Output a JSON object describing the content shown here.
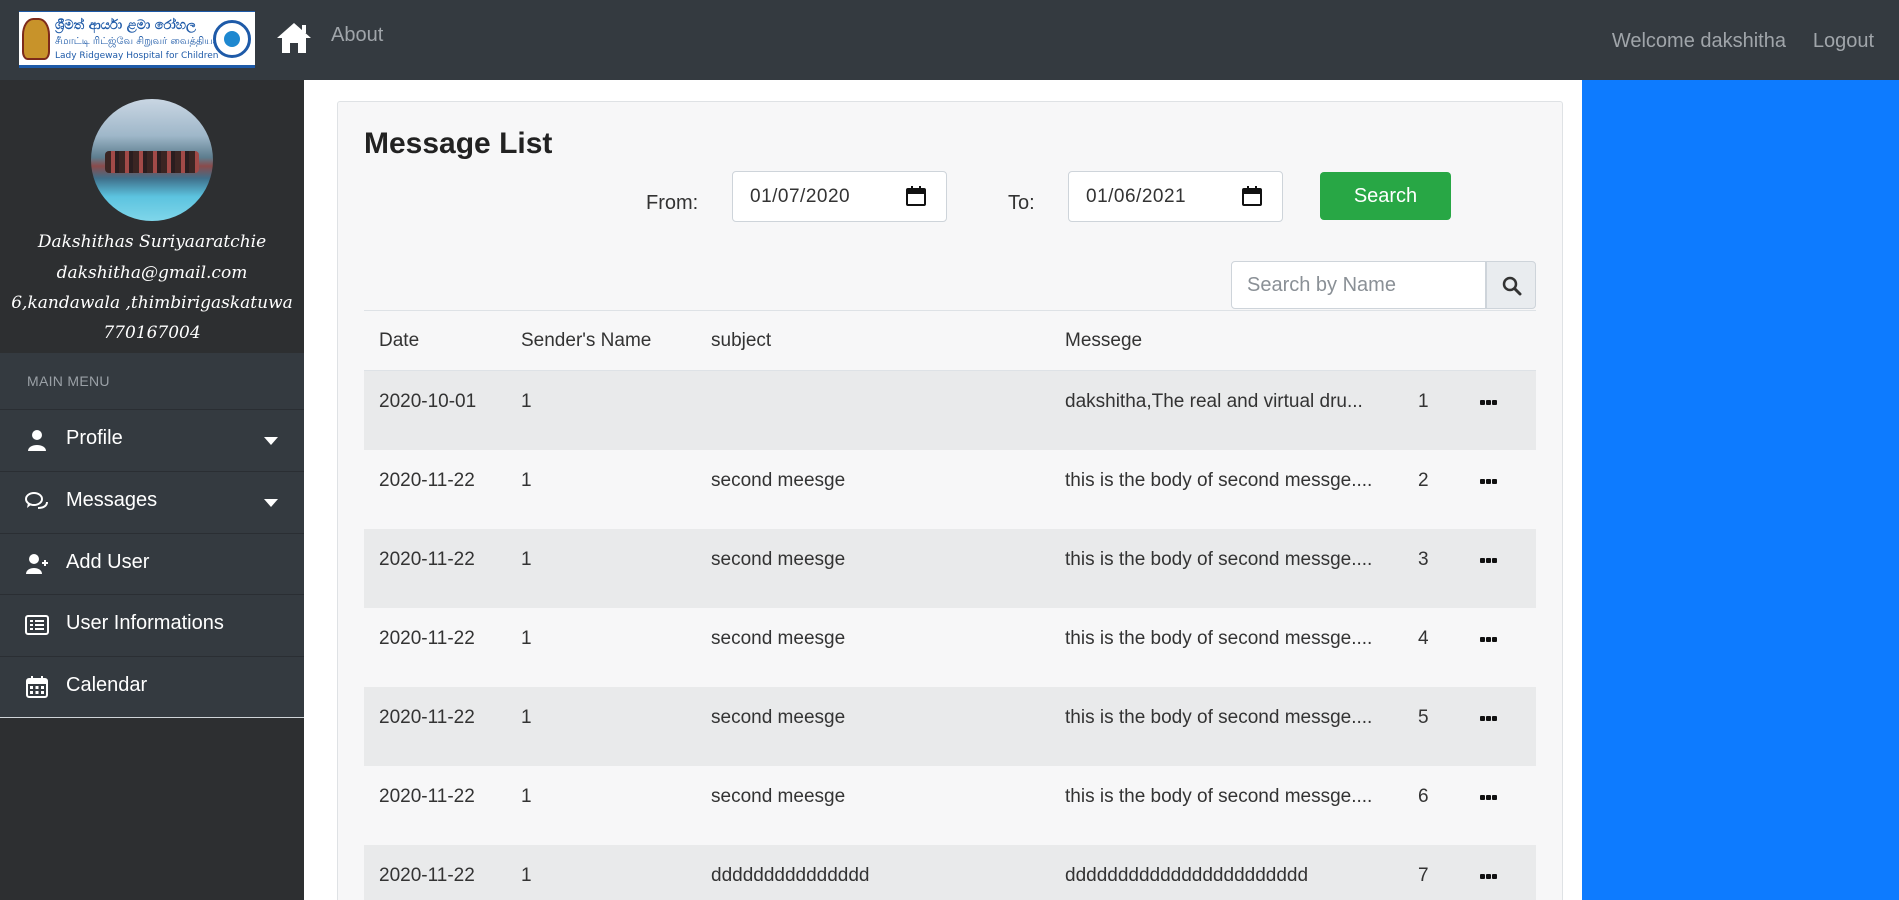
{
  "navbar": {
    "logo_line1": "ශ්‍රීමත් ආර්යා ළමා රෝහල",
    "logo_line2": "சீமாட்டி ரிட்ஜ்வே சிறுவர் வைத்தியசாலை",
    "logo_line3": "Lady Ridgeway Hospital for Children",
    "home_icon": "home-icon",
    "about": "About",
    "welcome": "Welcome dakshitha",
    "logout": "Logout"
  },
  "profile": {
    "name": "Dakshithas Suriyaaratchie",
    "email": "dakshitha@gmail.com",
    "address": "6,kandawala ,thimbirigaskatuwa",
    "phone": "770167004"
  },
  "sidebar": {
    "heading": "MAIN MENU",
    "items": [
      {
        "label": "Profile",
        "icon": "user-icon",
        "has_caret": true
      },
      {
        "label": "Messages",
        "icon": "comments-icon",
        "has_caret": true
      },
      {
        "label": "Add User",
        "icon": "user-plus-icon",
        "has_caret": false
      },
      {
        "label": "User Informations",
        "icon": "list-alt-icon",
        "has_caret": false
      },
      {
        "label": "Calendar",
        "icon": "calendar-icon",
        "has_caret": false
      }
    ]
  },
  "main": {
    "title": "Message List",
    "from_label": "From:",
    "from_value": "01/07/2020",
    "to_label": "To:",
    "to_value": "01/06/2021",
    "search_button": "Search",
    "search_placeholder": "Search by Name",
    "columns": [
      "Date",
      "Sender's Name",
      "subject",
      "Messege"
    ],
    "rows": [
      {
        "date": "2020-10-01",
        "sender": "1",
        "subject": "",
        "message": "dakshitha,The real and virtual dru...",
        "num": "1"
      },
      {
        "date": "2020-11-22",
        "sender": "1",
        "subject": "second meesge",
        "message": "this is the body of second messge....",
        "num": "2"
      },
      {
        "date": "2020-11-22",
        "sender": "1",
        "subject": "second meesge",
        "message": "this is the body of second messge....",
        "num": "3"
      },
      {
        "date": "2020-11-22",
        "sender": "1",
        "subject": "second meesge",
        "message": "this is the body of second messge....",
        "num": "4"
      },
      {
        "date": "2020-11-22",
        "sender": "1",
        "subject": "second meesge",
        "message": "this is the body of second messge....",
        "num": "5"
      },
      {
        "date": "2020-11-22",
        "sender": "1",
        "subject": "second meesge",
        "message": "this is the body of second messge....",
        "num": "6"
      },
      {
        "date": "2020-11-22",
        "sender": "1",
        "subject": "ddddddddddddddd",
        "message": "ddddddddddddddddddddddd",
        "num": "7"
      }
    ]
  },
  "colors": {
    "navbar": "#343a40",
    "sidebar": "#2d2f31",
    "menu": "#343a40",
    "search_button": "#28a745",
    "right_panel": "#0d7bff"
  }
}
